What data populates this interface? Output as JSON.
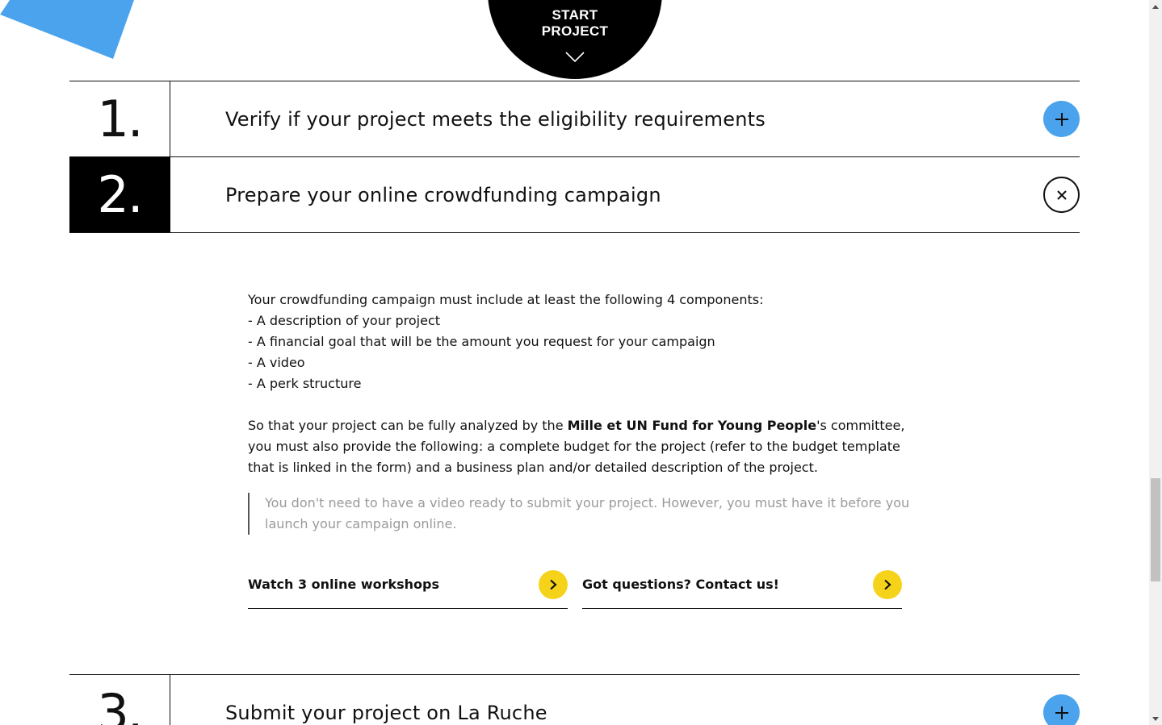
{
  "start": {
    "label": "START\nPROJECT"
  },
  "steps": [
    {
      "number": "1.",
      "title": "Verify if your project meets the eligibility requirements",
      "state": "collapsed",
      "toggle_icon": "plus-icon"
    },
    {
      "number": "2.",
      "title": "Prepare your online crowdfunding campaign",
      "state": "expanded",
      "toggle_icon": "close-icon",
      "content": {
        "intro": "Your crowdfunding campaign must include at least the following 4 components:",
        "components": [
          "- A description of your project",
          "- A financial goal that will be the amount you request for your campaign",
          "- A video",
          "- A perk structure"
        ],
        "para_before": "So that your project can be fully analyzed by the ",
        "para_bold": "Mille et UN Fund for Young People",
        "para_after": "'s committee, you must also provide the following: a complete budget for the project (refer to the budget template that is linked in the form) and a business plan and/or detailed description of the project.",
        "note": "You don't need to have a video ready to submit your project. However, you must have it before you launch your campaign online.",
        "links": [
          {
            "label": "Watch 3 online workshops",
            "icon": "chevron-right-icon"
          },
          {
            "label": "Got questions? Contact us!",
            "icon": "chevron-right-icon"
          }
        ]
      }
    },
    {
      "number": "3.",
      "title": "Submit your project on La Ruche",
      "state": "collapsed",
      "toggle_icon": "plus-icon"
    }
  ],
  "colors": {
    "accent_blue": "#4aa3ec",
    "accent_yellow": "#f6d31b",
    "black": "#000000",
    "quote_text": "#9a9a9a"
  }
}
